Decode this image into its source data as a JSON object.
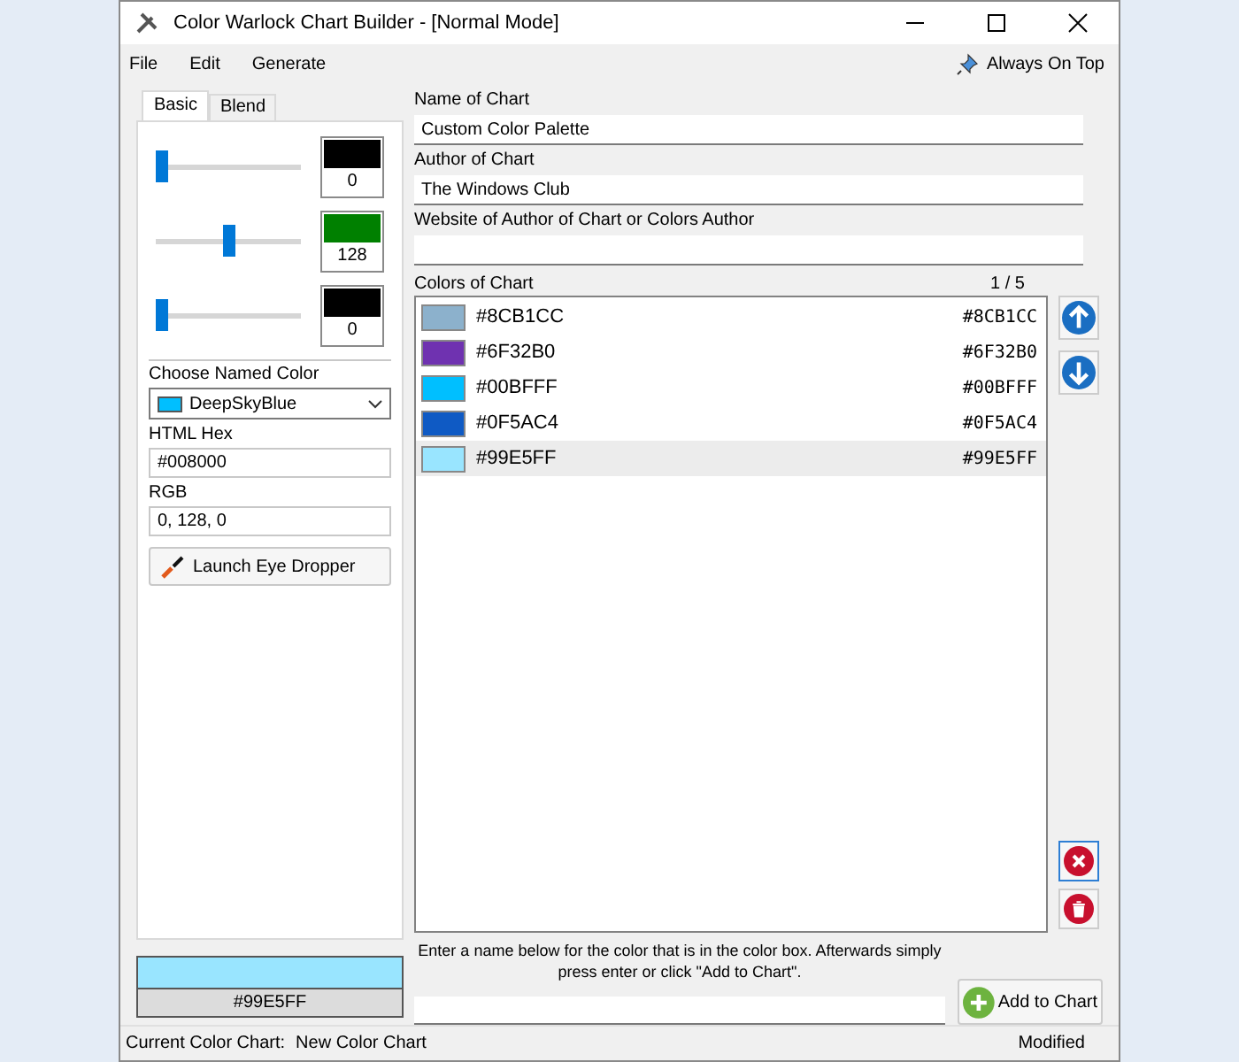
{
  "window": {
    "title": "Color Warlock Chart Builder - [Normal Mode]"
  },
  "menu": [
    "File",
    "Edit",
    "Generate"
  ],
  "always_on_top": {
    "label": "Always On Top"
  },
  "tabs": [
    {
      "label": "Basic",
      "selected": true
    },
    {
      "label": "Blend",
      "selected": false
    }
  ],
  "channels": [
    {
      "level": 0,
      "value": "0",
      "color": "#000000"
    },
    {
      "level": 0.5,
      "value": "128",
      "color": "#008000"
    },
    {
      "level": 0,
      "value": "0",
      "color": "#000000"
    }
  ],
  "named_color": {
    "label": "Choose Named Color",
    "value": "DeepSkyBlue",
    "color": "#00bfff"
  },
  "html_hex": {
    "label": "HTML Hex",
    "value": "#008000"
  },
  "rgb": {
    "label": "RGB",
    "value": "0, 128, 0"
  },
  "eye_dropper_button": {
    "label": "Launch Eye Dropper"
  },
  "name_of_chart": {
    "label": "Name of Chart",
    "value": "Custom Color Palette"
  },
  "author_of_chart": {
    "label": "Author of Chart",
    "value": "The Windows Club"
  },
  "website": {
    "label": "Website of Author of Chart or Colors Author"
  },
  "colors_of_chart": {
    "label": "Colors of Chart",
    "position": "1 / 5",
    "items": [
      {
        "name": "#8CB1CC",
        "hex": "#8CB1CC",
        "color": "#8cb1cc",
        "selected": false
      },
      {
        "name": "#6F32B0",
        "hex": "#6F32B0",
        "color": "#6f32b0",
        "selected": false
      },
      {
        "name": "#00BFFF",
        "hex": "#00BFFF",
        "color": "#00bfff",
        "selected": false
      },
      {
        "name": "#0F5AC4",
        "hex": "#0F5AC4",
        "color": "#0f5ac4",
        "selected": false
      },
      {
        "name": "#99E5FF",
        "hex": "#99E5FF",
        "color": "#99e5ff",
        "selected": true
      }
    ]
  },
  "preview": {
    "color": "#99e5ff",
    "hex": "#99E5FF"
  },
  "instructions": "Enter a name below for the color that is in the color box. Afterwards simply press enter or click \"Add to Chart\".",
  "add_button": {
    "label": "Add to Chart"
  },
  "status_bar": {
    "label": "Current Color Chart:",
    "value": "New Color Chart",
    "state": "Modified"
  }
}
